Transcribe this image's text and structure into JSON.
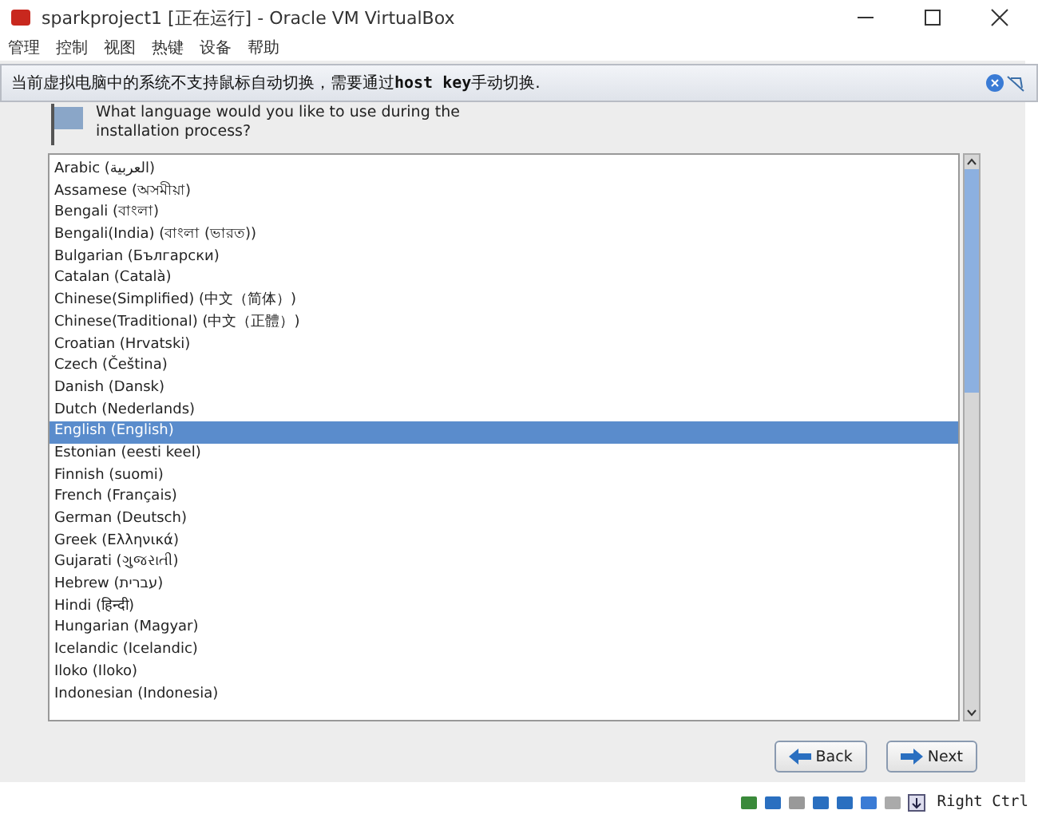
{
  "window": {
    "title": "sparkproject1 [正在运行] - Oracle VM VirtualBox"
  },
  "menu": [
    "管理",
    "控制",
    "视图",
    "热键",
    "设备",
    "帮助"
  ],
  "notice": {
    "text": "当前虚拟电脑中的系统不支持鼠标自动切换，需要通过**host key**手动切换."
  },
  "installer": {
    "prompt_lines": [
      "What language would you like to use during the",
      "installation process?"
    ],
    "languages": [
      {
        "label": "Arabic (العربية)",
        "selected": false
      },
      {
        "label": "Assamese (অসমীয়া)",
        "selected": false
      },
      {
        "label": "Bengali (বাংলা)",
        "selected": false
      },
      {
        "label": "Bengali(India) (বাংলা (ভারত))",
        "selected": false
      },
      {
        "label": "Bulgarian (Български)",
        "selected": false
      },
      {
        "label": "Catalan (Català)",
        "selected": false
      },
      {
        "label": "Chinese(Simplified) (中文（简体）)",
        "selected": false
      },
      {
        "label": "Chinese(Traditional) (中文（正體）)",
        "selected": false
      },
      {
        "label": "Croatian (Hrvatski)",
        "selected": false
      },
      {
        "label": "Czech (Čeština)",
        "selected": false
      },
      {
        "label": "Danish (Dansk)",
        "selected": false
      },
      {
        "label": "Dutch (Nederlands)",
        "selected": false
      },
      {
        "label": "English (English)",
        "selected": true
      },
      {
        "label": "Estonian (eesti keel)",
        "selected": false
      },
      {
        "label": "Finnish (suomi)",
        "selected": false
      },
      {
        "label": "French (Français)",
        "selected": false
      },
      {
        "label": "German (Deutsch)",
        "selected": false
      },
      {
        "label": "Greek (Ελληνικά)",
        "selected": false
      },
      {
        "label": "Gujarati (ગુજરાતી)",
        "selected": false
      },
      {
        "label": "Hebrew (עברית)",
        "selected": false
      },
      {
        "label": "Hindi (हिन्दी)",
        "selected": false
      },
      {
        "label": "Hungarian (Magyar)",
        "selected": false
      },
      {
        "label": "Icelandic (Icelandic)",
        "selected": false
      },
      {
        "label": "Iloko (Iloko)",
        "selected": false
      },
      {
        "label": "Indonesian (Indonesia)",
        "selected": false
      }
    ],
    "buttons": [
      {
        "label": "Back",
        "kind": "back"
      },
      {
        "label": "Next",
        "kind": "next"
      }
    ]
  },
  "status_bar": {
    "host_key": "Right Ctrl"
  }
}
